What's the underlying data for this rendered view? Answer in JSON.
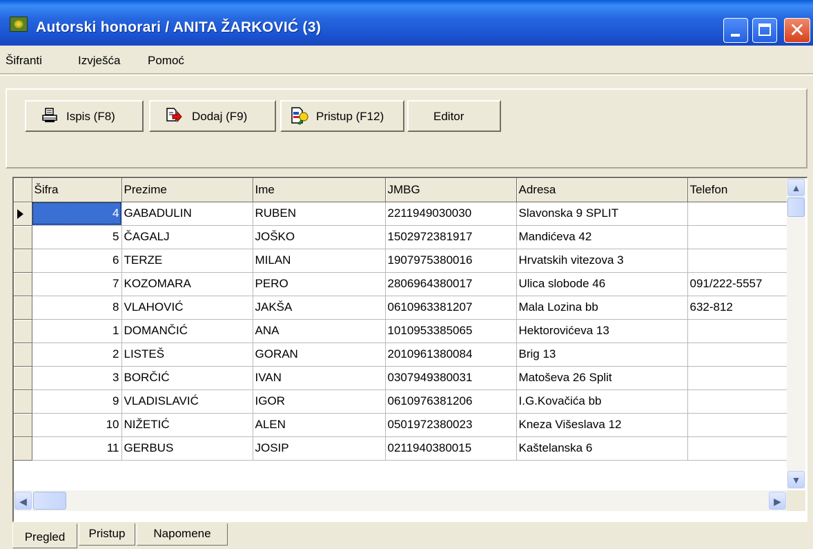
{
  "window": {
    "title": "Autorski honorari / ANITA ŽARKOVIĆ (3)"
  },
  "menu": [
    "Šifranti",
    "Izvješća",
    "Pomoć"
  ],
  "toolbar": {
    "print_label": "Ispis (F8)",
    "add_label": "Dodaj (F9)",
    "access_label": "Pristup (F12)",
    "editor_label": "Editor"
  },
  "table": {
    "columns": [
      "Šifra",
      "Prezime",
      "Ime",
      "JMBG",
      "Adresa",
      "Telefon"
    ],
    "rows": [
      [
        "4",
        "GABADULIN",
        "RUBEN",
        "2211949030030",
        "Slavonska 9 SPLIT",
        ""
      ],
      [
        "5",
        "ČAGALJ",
        "JOŠKO",
        "1502972381917",
        "Mandićeva 42",
        ""
      ],
      [
        "6",
        "TERZE",
        "MILAN",
        "1907975380016",
        "Hrvatskih vitezova 3",
        ""
      ],
      [
        "7",
        "KOZOMARA",
        "PERO",
        "2806964380017",
        "Ulica slobode 46",
        "091/222-5557"
      ],
      [
        "8",
        "VLAHOVIĆ",
        "JAKŠA",
        "0610963381207",
        "Mala Lozina bb",
        "632-812"
      ],
      [
        "1",
        "DOMANČIĆ",
        "ANA",
        "1010953385065",
        "Hektorovićeva 13",
        ""
      ],
      [
        "2",
        "LISTEŠ",
        "GORAN",
        "2010961380084",
        "Brig 13",
        ""
      ],
      [
        "3",
        "BORČIĆ",
        "IVAN",
        "0307949380031",
        "Matoševa 26 Split",
        ""
      ],
      [
        "9",
        "VLADISLAVIĆ",
        "IGOR",
        "0610976381206",
        "I.G.Kovačića bb",
        ""
      ],
      [
        "10",
        "NIŽETIĆ",
        "ALEN",
        "0501972380023",
        "Kneza Višeslava 12",
        ""
      ],
      [
        "11",
        "GERBUS",
        "JOSIP",
        "0211940380015",
        "Kaštelanska 6",
        ""
      ]
    ],
    "selected_row": 0
  },
  "tabs": [
    {
      "label": "Pregled",
      "active": true
    },
    {
      "label": "Pristup",
      "active": false
    },
    {
      "label": "Napomene",
      "active": false
    }
  ],
  "colors": {
    "titlebar": "#2667e0",
    "selection": "#3a6fd4",
    "face": "#ece9d8"
  }
}
